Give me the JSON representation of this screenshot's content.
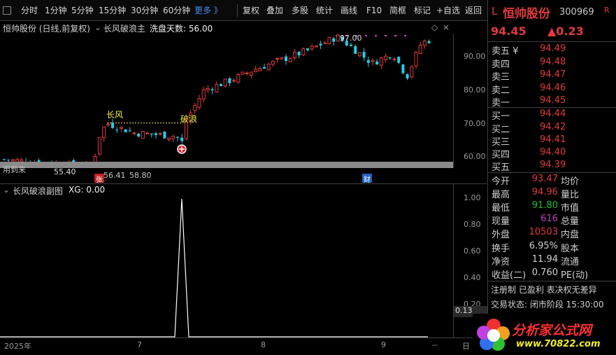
{
  "toolbar": {
    "items": [
      {
        "label": "分时"
      },
      {
        "label": "1分钟"
      },
      {
        "label": "5分钟"
      },
      {
        "label": "15分钟"
      },
      {
        "label": "30分钟"
      },
      {
        "label": "60分钟"
      },
      {
        "label": "更多 》"
      },
      {
        "label": "复权"
      },
      {
        "label": "叠加"
      },
      {
        "label": "多股"
      },
      {
        "label": "统计"
      },
      {
        "label": "画线"
      },
      {
        "label": "F10"
      },
      {
        "label": "简框"
      },
      {
        "label": "标记"
      },
      {
        "label": "+自选"
      },
      {
        "label": "返回"
      }
    ]
  },
  "main_chart": {
    "stock_label": "恒帅股份 (日线,前复权)",
    "indicator_name": "长风破浪主",
    "indicator_value": "洗盘天数: 56.00",
    "price_ticks": [
      "90.00",
      "80.00",
      "70.00",
      "60.00"
    ],
    "high_annotation": "97.00",
    "low_annotation": "55.40",
    "annotation_changfeng": "长风",
    "annotation_polang": "破浪",
    "overlay_text": "用到来",
    "extra_labels": [
      "56.41",
      "58.80"
    ],
    "event_zhang": "张",
    "event_cai": "财"
  },
  "sub_chart": {
    "title": "长风破浪副图",
    "value_text": "XG: 0.00",
    "ticks": [
      "1.00",
      "0.80",
      "0.60",
      "0.40",
      "0.20"
    ],
    "cursor_value": "0.13"
  },
  "date_axis": {
    "labels": [
      "2025年",
      "7",
      "8",
      "9"
    ],
    "nav_dash": "--",
    "nav_day": "日"
  },
  "quote_panel": {
    "market_flag": "L",
    "name": "恒帅股份",
    "code": "300969",
    "r_flag": "R",
    "price": "94.45",
    "change": "▲0.23",
    "sell": [
      {
        "label": "卖五 ¥",
        "price": "94.49"
      },
      {
        "label": "卖四",
        "price": "94.48"
      },
      {
        "label": "卖三",
        "price": "94.47"
      },
      {
        "label": "卖二",
        "price": "94.46"
      },
      {
        "label": "卖一",
        "price": "94.45"
      }
    ],
    "buy": [
      {
        "label": "买一",
        "price": "94.44"
      },
      {
        "label": "买二",
        "price": "94.42"
      },
      {
        "label": "买三",
        "price": "94.41"
      },
      {
        "label": "买四",
        "price": "94.40"
      },
      {
        "label": "买五",
        "price": "94.39"
      }
    ],
    "stats": [
      {
        "label": "今开",
        "value": "93.47",
        "color": "#e23a3a",
        "label2": "均价"
      },
      {
        "label": "最高",
        "value": "94.96",
        "color": "#e23a3a",
        "label2": "量比"
      },
      {
        "label": "最低",
        "value": "91.80",
        "color": "#20c020",
        "label2": "市值"
      },
      {
        "label": "现量",
        "value": "616",
        "color": "#c040c0",
        "label2": "总量"
      },
      {
        "label": "外盘",
        "value": "10503",
        "color": "#e23a3a",
        "label2": "内盘"
      },
      {
        "label": "换手",
        "value": "6.95%",
        "color": "#d0d0d0",
        "label2": "股本"
      },
      {
        "label": "净资",
        "value": "11.94",
        "color": "#d0d0d0",
        "label2": "流通"
      },
      {
        "label": "收益(二)",
        "value": "0.760",
        "color": "#d0d0d0",
        "label2": "PE(动)"
      }
    ],
    "registration": "注册制 已盈利 表决权无差异",
    "trade_status": "交易状态: 闭市阶段 15:30:00"
  },
  "logo": {
    "line1": "分析家公式网",
    "line2": "www.70822.com"
  },
  "colors": {
    "up": "#e23a3a",
    "down": "#20d0e8",
    "accent": "#4a8cf0",
    "text": "#c8c8c8"
  }
}
